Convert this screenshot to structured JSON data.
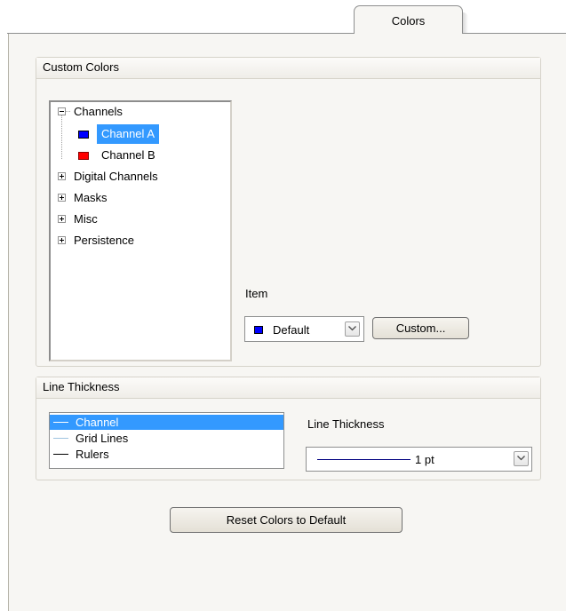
{
  "tabs": [
    {
      "label": "Colors"
    }
  ],
  "custom_colors": {
    "title": "Custom Colors",
    "tree": [
      {
        "label": "Channels",
        "expanded": true,
        "children": [
          {
            "label": "Channel A",
            "color": "#0000ff",
            "selected": true
          },
          {
            "label": "Channel B",
            "color": "#ff0000",
            "selected": false
          }
        ]
      },
      {
        "label": "Digital Channels",
        "expanded": false
      },
      {
        "label": "Masks",
        "expanded": false
      },
      {
        "label": "Misc",
        "expanded": false
      },
      {
        "label": "Persistence",
        "expanded": false
      }
    ],
    "item_label": "Item",
    "item_select": {
      "value": "Default",
      "color": "#0000ff"
    },
    "custom_button": "Custom..."
  },
  "line_thickness": {
    "title": "Line Thickness",
    "items": [
      {
        "label": "Channel",
        "color": "#ffffff",
        "selected": true
      },
      {
        "label": "Grid Lines",
        "color": "#9fc3e0",
        "selected": false
      },
      {
        "label": "Rulers",
        "color": "#000000",
        "selected": false
      }
    ],
    "thickness_label": "Line Thickness",
    "thickness_select": {
      "value": "1 pt",
      "line_color": "#000080"
    }
  },
  "reset_button": "Reset Colors to Default",
  "colors": {
    "selection": "#3399ff",
    "panel_bg": "#f7f6f3",
    "border": "#8e8f8f"
  }
}
